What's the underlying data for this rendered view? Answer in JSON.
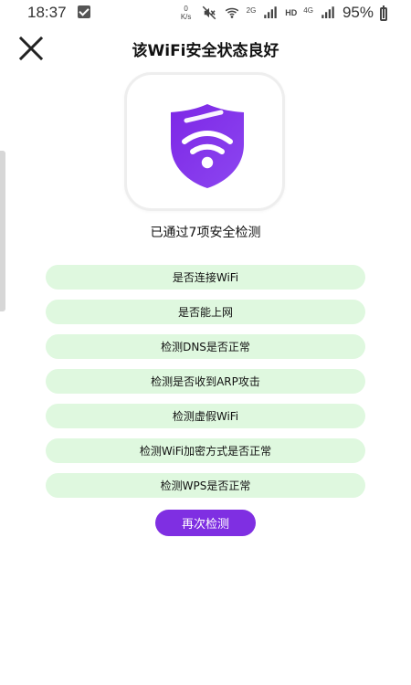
{
  "status_bar": {
    "time": "18:37",
    "speed_top": "0",
    "speed_bottom": "K/s",
    "network_2g": "2G",
    "network_4g": "4G",
    "hd": "HD",
    "battery_percent": "95%"
  },
  "header": {
    "title": "该WiFi安全状态良好"
  },
  "hero": {
    "icon": "shield-wifi-icon",
    "accent_color": "#7f2fe2"
  },
  "summary": {
    "passed_text": "已通过7项安全检测"
  },
  "checks": [
    {
      "label": "是否连接WiFi"
    },
    {
      "label": "是否能上网"
    },
    {
      "label": "检测DNS是否正常"
    },
    {
      "label": "检测是否收到ARP攻击"
    },
    {
      "label": "检测虚假WiFi"
    },
    {
      "label": "检测WiFi加密方式是否正常"
    },
    {
      "label": "检测WPS是否正常"
    }
  ],
  "actions": {
    "recheck_label": "再次检测"
  },
  "colors": {
    "check_background": "#dff8df",
    "button_background": "#7f2fe2"
  }
}
